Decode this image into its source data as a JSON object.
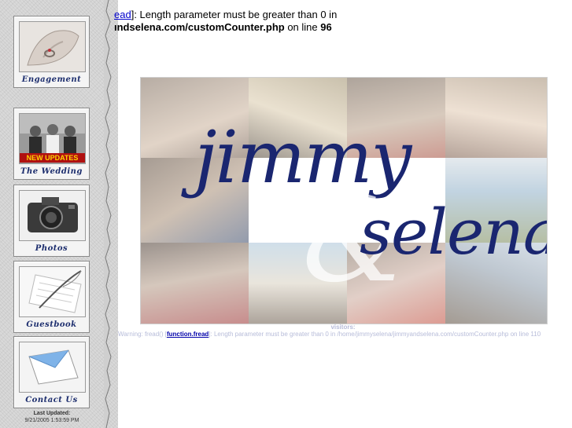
{
  "error": {
    "line1_link": "ead",
    "line1_text": "]: Length parameter must be greater than 0 in",
    "line2_path": "ındselena.com/customCounter.php",
    "line2_mid": " on line ",
    "line2_num": "96"
  },
  "nav": {
    "items": [
      {
        "label": "Engagement",
        "icon": "ring-hand-icon"
      },
      {
        "label": "The Wedding",
        "icon": "wedding-photo-icon",
        "badge": "NEW UPDATES"
      },
      {
        "label": "Photos",
        "icon": "camera-icon"
      },
      {
        "label": "Guestbook",
        "icon": "quill-pen-icon"
      },
      {
        "label": "Contact Us",
        "icon": "envelope-icon"
      }
    ],
    "last_updated_label": "Last Updated:",
    "last_updated_value": "9/21/2005 1:53:59 PM"
  },
  "banner": {
    "name1": "jimmy",
    "amp": "&",
    "name2": "selena"
  },
  "footer": {
    "visitors_label": "visitors:",
    "warn_prefix": "Warning: fread() [",
    "warn_fn": "function.fread",
    "warn_suffix": "]: Length parameter must be greater than 0 in /home/jimmyselena/jimmyandselena.com/customCounter.php on line 110"
  },
  "colors": {
    "sidebar": "#d9d9d9",
    "script": "#1a2670",
    "badge_bg": "#b01010",
    "badge_text": "#ffd400"
  }
}
